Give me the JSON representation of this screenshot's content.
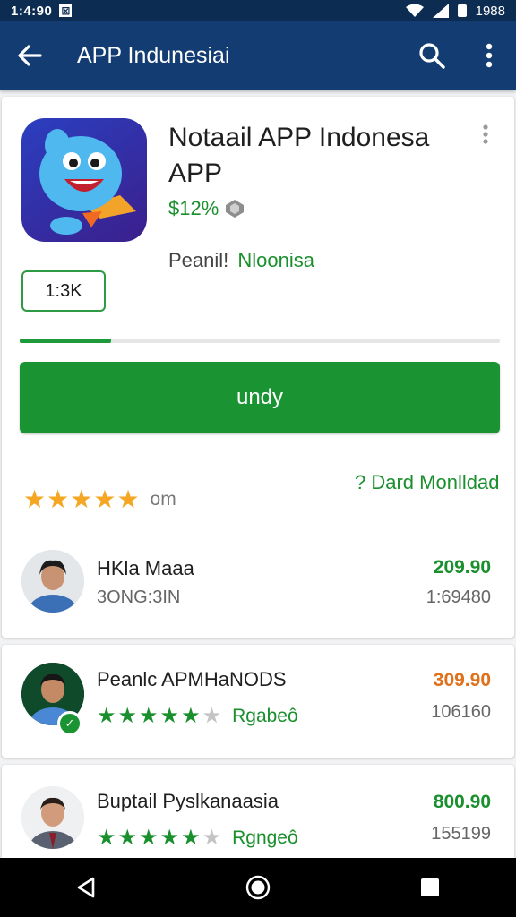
{
  "status_bar": {
    "time": "1:4:90",
    "battery_text": "1988"
  },
  "app_bar": {
    "title": "APP Indunesiai"
  },
  "app": {
    "title": "Notaail APP Indonesa APP",
    "price": "$12%",
    "publisher_label": "Peanil!",
    "publisher_name": "Nloonisa",
    "size_badge": "1:3K",
    "install_label": "undy",
    "download_link": "? Dard Monlldad",
    "rating_count": "om",
    "progress_fraction": 0.19
  },
  "developers": [
    {
      "name": "HKla Maaa",
      "sub": "3ONG:3IN",
      "price": "209.90",
      "count": "1:69480",
      "price_color": "#1a8f2e"
    },
    {
      "name": "Peanlc APMHaNODS",
      "rating_label": "Rgabeô",
      "price": "309.90",
      "count": "106160",
      "price_color": "#e0701a"
    },
    {
      "name": "Buptail Pyslkanaasia",
      "rating_label": "Rgngeô",
      "price": "800.90",
      "count": "155199",
      "price_color": "#1a8f2e"
    }
  ],
  "colors": {
    "app_bar": "#133d72",
    "status_bar": "#0d2c52",
    "accent_green": "#1a9432",
    "star_gold": "#f5a623"
  }
}
